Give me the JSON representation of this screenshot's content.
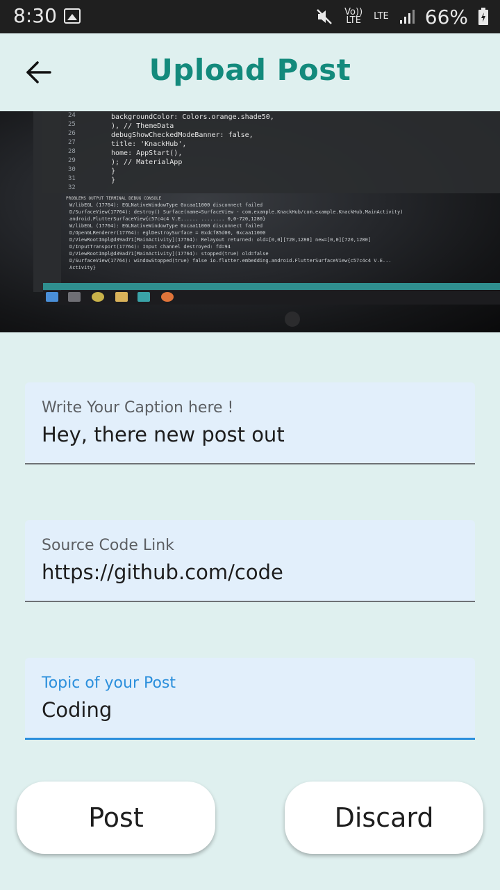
{
  "status_bar": {
    "time": "8:30",
    "volte_label": "Vo)) LTE",
    "lte_label": "LTE",
    "battery_percent": "66%",
    "icons": [
      "gallery-icon",
      "mute-icon",
      "signal-icon",
      "battery-icon"
    ]
  },
  "app_bar": {
    "title": "Upload Post",
    "back_icon": "arrow-left-icon",
    "title_color": "#138a7c"
  },
  "image_preview": {
    "line_numbers": [
      "24",
      "25",
      "26",
      "27",
      "28",
      "29",
      "30",
      "31",
      "32"
    ],
    "code_lines": [
      "backgroundColor: Colors.orange.shade50,",
      "), // ThemeData",
      "debugShowCheckedModeBanner: false,",
      "title: 'KnackHub',",
      "home: AppStart(),",
      "); // MaterialApp",
      "}",
      "}"
    ],
    "console_tabs": "PROBLEMS  OUTPUT  TERMINAL  DEBUG CONSOLE",
    "console_lines": [
      "W/libEGL  (17764): EGLNativeWindowType 0xcaa11000 disconnect failed",
      "D/SurfaceView(17764): destroy() Surface(name=SurfaceView - com.example.KnackHub/com.example.KnackHub.MainActivity)",
      "android.FlutterSurfaceView{c57c4c4 V.E...... ........ 0,0-720,1280}",
      "W/libEGL  (17764): EGLNativeWindowType 0xcaa11000 disconnect failed",
      "D/OpenGLRenderer(17764): eglDestroySurface = 0xdcf85d00, 0xcaa11000",
      "D/ViewRootImpl@d39ad71[MainActivity](17764): Relayout returned: old=[0,0][720,1280] new=[0,0][720,1280]",
      "D/InputTransport(17764): Input channel destroyed: fd=94",
      "D/ViewRootImpl@d39ad71[MainActivity](17764): stopped(true) old=false",
      "D/SurfaceView(17764): windowStopped(true) false io.flutter.embedding.android.FlutterSurfaceView{c57c4c4 V.E...",
      "Activity}"
    ]
  },
  "form": {
    "caption": {
      "label": "Write Your Caption here !",
      "value": "Hey, there new post out"
    },
    "source": {
      "label": "Source Code Link",
      "value": "https://github.com/code"
    },
    "topic": {
      "label": "Topic of your Post",
      "value": "Coding",
      "focused": true
    }
  },
  "actions": {
    "post_label": "Post",
    "discard_label": "Discard"
  },
  "colors": {
    "background": "#dff0ef",
    "field_background": "#e2effb",
    "focus_accent": "#2b8fdc",
    "title_teal": "#138a7c"
  }
}
